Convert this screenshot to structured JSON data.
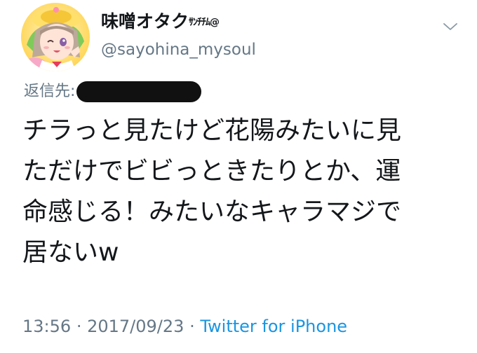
{
  "author": {
    "display_name": "味噌オタク",
    "display_name_suffix": "ｻﾝﾁﾁﾑ@",
    "screen_name": "@sayohina_mysoul"
  },
  "reply": {
    "label": "返信先:"
  },
  "tweet": {
    "lines": [
      "チラっと見たけど花陽みたいに見",
      "ただけでビビっときたりとか、運",
      "命感じる！みたいなキャラマジで",
      "居ないw"
    ]
  },
  "meta": {
    "time": "13:56",
    "separator_1": "·",
    "date": "2017/09/23",
    "separator_2": "·",
    "source": "Twitter for iPhone"
  },
  "icons": {
    "avatar": "avatar-image",
    "caret": "chevron-down-icon"
  },
  "colors": {
    "text": "#14171a",
    "muted": "#657786",
    "link": "#1b95e0",
    "redaction": "#111111"
  }
}
